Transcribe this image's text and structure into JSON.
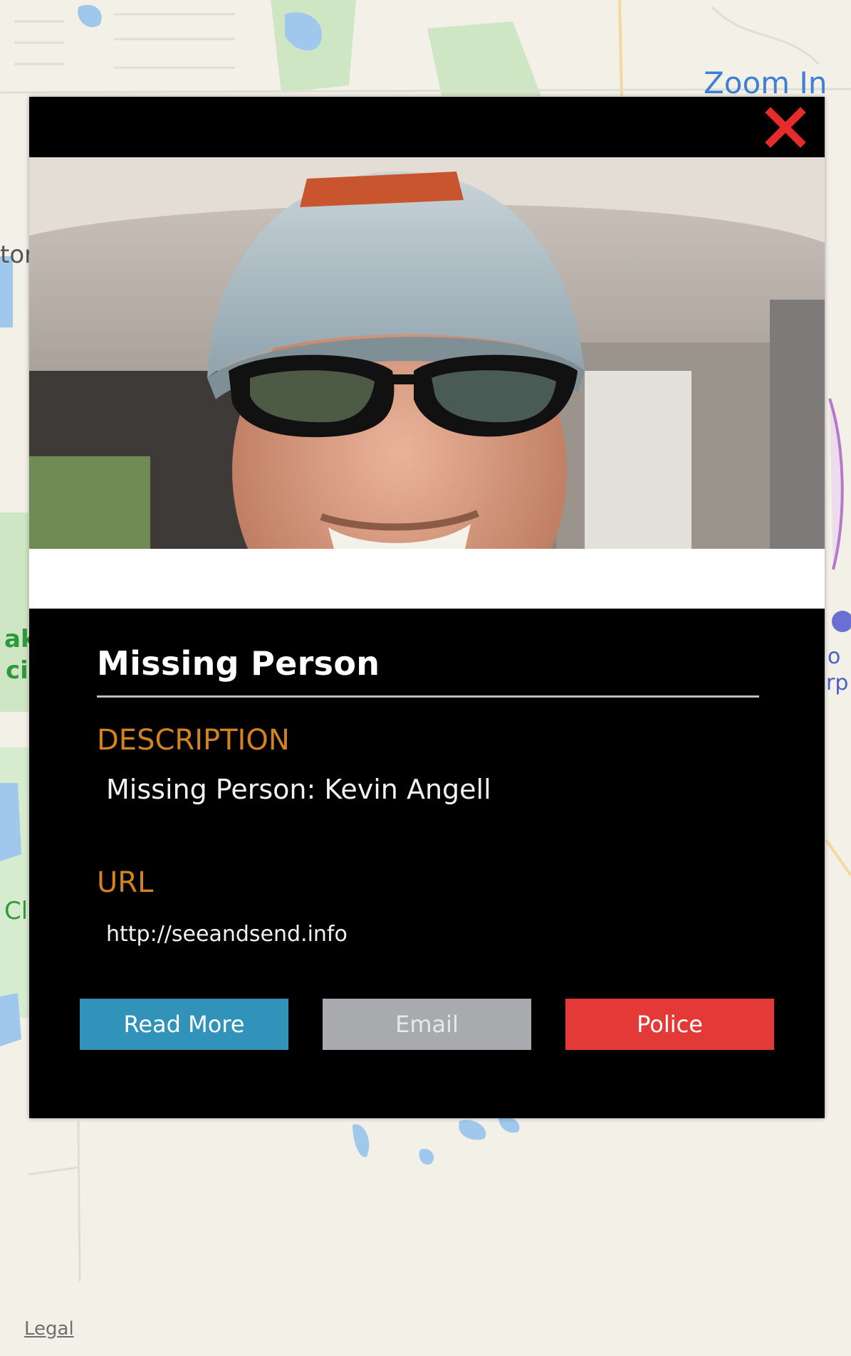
{
  "map": {
    "zoom_in_label": "Zoom In",
    "legal_label": "Legal",
    "edge_labels": {
      "left_top": "tor",
      "left_mid_a": "ak",
      "left_mid_b": "ci",
      "left_low": "Cl",
      "right_a": "o",
      "right_b": "rp"
    }
  },
  "modal": {
    "close_icon": "close-x-icon",
    "photo_alt": "Photo of missing person",
    "title": "Missing Person",
    "description": {
      "label": "DESCRIPTION",
      "value": "Missing Person: Kevin Angell"
    },
    "url": {
      "label": "URL",
      "value": "http://seeandsend.info"
    },
    "buttons": {
      "read_more": "Read More",
      "email": "Email",
      "police": "Police"
    }
  },
  "colors": {
    "accent_label": "#d4821f",
    "read_more": "#3193b9",
    "email": "#a8aaad",
    "police": "#e43a37",
    "close": "#e52b2b",
    "map_link": "#3f7fd2"
  }
}
